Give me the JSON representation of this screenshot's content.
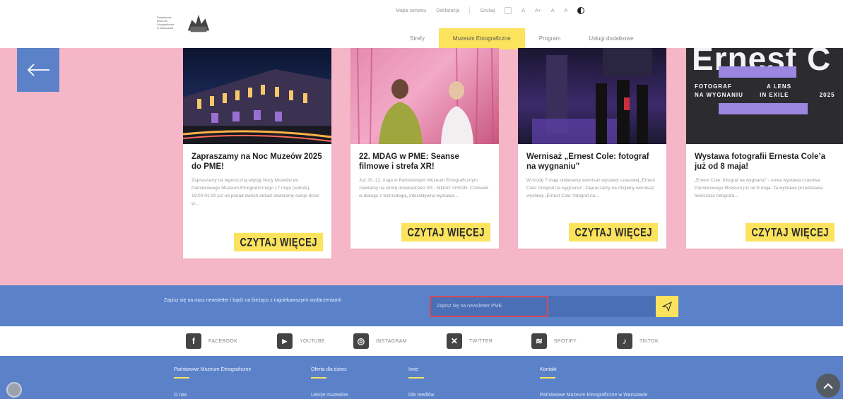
{
  "header": {
    "logo_lines": [
      "Państwowe",
      "Muzeum",
      "Etnograficzne",
      "w Warszawie"
    ],
    "util": [
      "Mapa serwisu",
      "Deklaracja",
      "Szukaj",
      "A",
      "A+",
      "A",
      "A"
    ],
    "nav": [
      {
        "label": "Strefy",
        "active": false
      },
      {
        "label": "Muzeum Etnograficzne",
        "active": true
      },
      {
        "label": "Program",
        "active": false
      },
      {
        "label": "Usługi dodatkowe",
        "active": false
      }
    ]
  },
  "carousel": {
    "prev_icon": "arrow-left-icon",
    "next_icon": "arrow-right-icon",
    "cards": [
      {
        "title": "Zapraszamy na Noc Muzeów 2025 do PME!",
        "excerpt": "Zapraszamy na tegoroczną edycję Nocy Muzeów do Państwowego Muzeum Etnograficznego 17 maja (sobota), 19:00-01:00 już od ponad dwóch dekad otwieramy swoje drzwi w…",
        "cta": "CZYTAJ WIĘCEJ"
      },
      {
        "title": "22. MDAG w PME: Seanse filmowe i strefa XR!",
        "excerpt": "Już 20.-12. maja w Państwowym Muzeum Etnograficznym zawitamy na strefę doświadczeń XR - MDAG VISION. Człowiek w dialogu z technologią, interaktywna wystawa…",
        "cta": "CZYTAJ WIĘCEJ"
      },
      {
        "title": "Wernisaż „Ernest Cole: fotograf na wygnaniu”",
        "excerpt": "W środę 7 maja otwieramy wernisaż wystawy czasowej „Ernest Cole: fotograf na wygnaniu”. Zapraszamy na oficjalny wernisaż wystawy „Ernest Cole: fotograf na…",
        "cta": "CZYTAJ WIĘCEJ"
      },
      {
        "title": "Wystawa fotografii Ernesta Cole’a już od 8 maja!",
        "excerpt": "„Ernest Cole: fotograf na wygnaniu” - nowa wystawa czasowa Państwowego Muzeum już od 8 maja. Ta wystawa przedstawia twórczość fotografa…",
        "cta": "CZYTAJ WIĘCEJ",
        "poster": {
          "title": "Ernest C",
          "line1a": "FOTOGRAF",
          "line1b": "A LENS",
          "line2a": "NA WYGNANIU",
          "line2b": "IN EXILE",
          "year": "2025"
        }
      }
    ]
  },
  "newsletter": {
    "text": "Zapisz się na nasz newsletter i bądź na bieżąco z najciekawszymi wydarzeniami!",
    "placeholder": "Zapisz się na newsletter PME",
    "send_icon": "paper-plane-icon"
  },
  "social": [
    {
      "label": "FACEBOOK",
      "icon": "facebook-icon",
      "glyph": "f"
    },
    {
      "label": "YOUTUBE",
      "icon": "youtube-icon",
      "glyph": "▶"
    },
    {
      "label": "INSTAGRAM",
      "icon": "instagram-icon",
      "glyph": "◎"
    },
    {
      "label": "TWITTER",
      "icon": "twitter-x-icon",
      "glyph": "✕"
    },
    {
      "label": "SPOTIFY",
      "icon": "spotify-icon",
      "glyph": "≋"
    },
    {
      "label": "TIKTOK",
      "icon": "tiktok-icon",
      "glyph": "♪"
    }
  ],
  "footer": {
    "cols": [
      {
        "head": "Państwowe Muzeum Etnograficzne",
        "link": "O nas"
      },
      {
        "head": "Oferta dla dzieci",
        "link": "Lekcje muzealne"
      },
      {
        "head": "Inne",
        "link": "Dla mediów"
      },
      {
        "head": "Kontakt",
        "link": "Państwowe Muzeum Etnograficzne w Warszawie"
      }
    ]
  },
  "colors": {
    "pink": "#f5b7c8",
    "blue": "#5b82c9",
    "yellow": "#fbe35d",
    "red": "#d24a5d"
  }
}
